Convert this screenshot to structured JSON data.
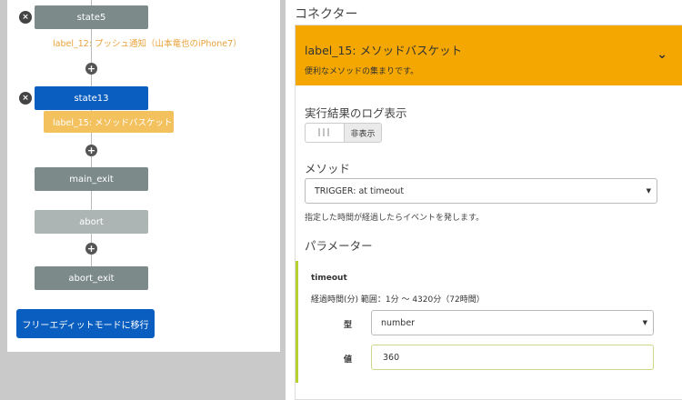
{
  "flow": {
    "nodes": [
      {
        "label": "state5"
      },
      {
        "label": "state13"
      },
      {
        "label": "main_exit"
      },
      {
        "label": "abort"
      },
      {
        "label": "abort_exit"
      }
    ],
    "labels": {
      "label_12": "label_12: プッシュ通知（山本竜也のiPhone7）",
      "label_15": "label_15: メソッドバスケット"
    },
    "plus_icon": "+",
    "remove_icon": "×",
    "free_edit_button": "フリーエディットモードに移行"
  },
  "connector": {
    "section_title": "コネクター",
    "card": {
      "title": "label_15: メソッドバスケット",
      "subtitle": "便利なメソッドの集まりです。"
    },
    "log_label": "実行結果のログ表示",
    "log_toggle": {
      "on": "|||",
      "off": "非表示"
    },
    "method_label": "メソッド",
    "method_value": "TRIGGER: at timeout",
    "method_hint": "指定した時間が経過したらイベントを発します。",
    "params_label": "パラメーター",
    "param": {
      "name": "timeout",
      "description": "経過時間(分) 範囲：1分 ～ 4320分（72時間）",
      "type_label": "型",
      "type_value": "number",
      "value_label": "値",
      "value": "360"
    }
  },
  "colors": {
    "header": "#f3a700",
    "primary_blue": "#0a5ebf",
    "label_highlight": "#f3c15e",
    "param_accent": "#b6d232"
  }
}
